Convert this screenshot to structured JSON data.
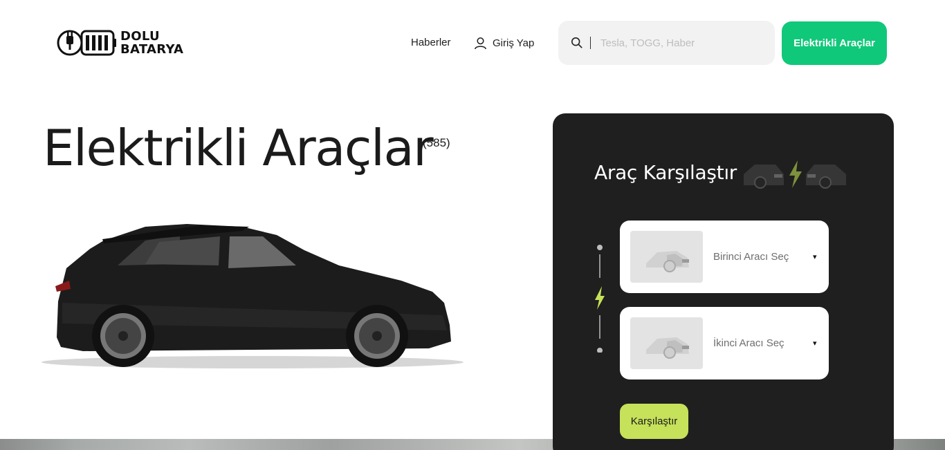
{
  "header": {
    "logo": {
      "line1": "DOLU",
      "line2": "BATARYA",
      "icon": "battery-plug-icon"
    },
    "nav": {
      "news_label": "Haberler",
      "login_label": "Giriş Yap",
      "login_icon": "user-icon"
    },
    "search": {
      "placeholder": "Tesla, TOGG, Haber",
      "icon": "search-icon"
    },
    "cta_label": "Elektrikli Araçlar"
  },
  "hero": {
    "title": "Elektrikli Araçlar",
    "count": "(585)",
    "image": "black-electric-suv"
  },
  "compare": {
    "title": "Araç Karşılaştır",
    "first_select_label": "Birinci Aracı Seç",
    "second_select_label": "İkinci Aracı Seç",
    "submit_label": "Karşılaştır",
    "caret": "▾",
    "icons": [
      "car-front-icon",
      "lightning-icon",
      "car-front-icon"
    ]
  },
  "colors": {
    "accent_green": "#10c879",
    "lime": "#c6e15a",
    "panel_bg": "#1f1f1f",
    "search_bg": "#f2f2f2"
  }
}
